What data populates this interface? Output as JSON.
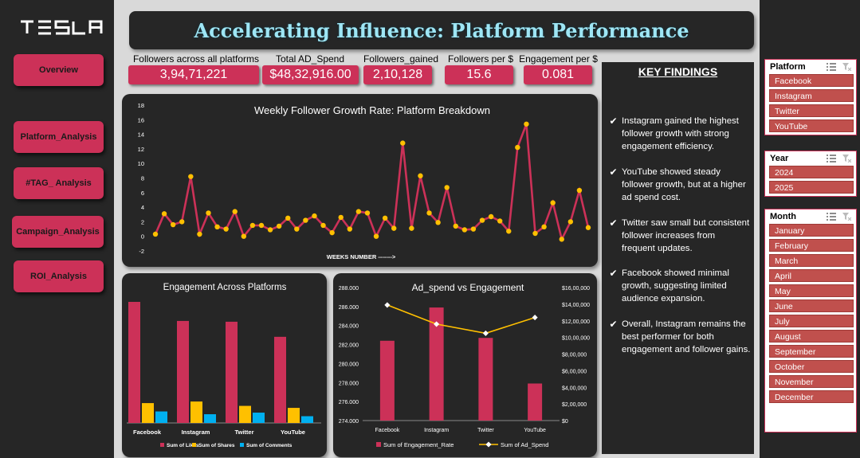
{
  "brand": {
    "logo_text": "TESLA"
  },
  "nav": [
    {
      "label": "Overview"
    },
    {
      "label": "Platform_Analysis"
    },
    {
      "label": "#TAG_ Analysis"
    },
    {
      "label": "Campaign_Analysis"
    },
    {
      "label": "ROI_Analysis"
    }
  ],
  "title": "Accelerating Influence: Platform Performance",
  "kpis": [
    {
      "label": "Followers across all platforms",
      "value": "3,94,71,221"
    },
    {
      "label": "Total AD_Spend",
      "value": "$48,32,916.00"
    },
    {
      "label": "Followers_gained",
      "value": "2,10,128"
    },
    {
      "label": "Followers per $",
      "value": "15.6"
    },
    {
      "label": "Engagement per $",
      "value": "0.081"
    }
  ],
  "findings": {
    "heading": "KEY FINDINGS",
    "items": [
      "Instagram gained the highest follower growth with strong engagement efficiency.",
      "YouTube showed steady follower growth, but at a higher ad spend cost.",
      "Twitter saw small but consistent follower increases from frequent updates.",
      "Facebook showed minimal growth, suggesting limited audience expansion.",
      "Overall, Instagram remains the best performer for both engagement and follower gains."
    ]
  },
  "slicers": {
    "platform": {
      "title": "Platform",
      "items": [
        "Facebook",
        "Instagram",
        "Twitter",
        "YouTube"
      ]
    },
    "year": {
      "title": "Year",
      "items": [
        "2024",
        "2025"
      ]
    },
    "month": {
      "title": "Month",
      "items": [
        "January",
        "February",
        "March",
        "April",
        "May",
        "June",
        "July",
        "August",
        "September",
        "October",
        "November",
        "December"
      ]
    }
  },
  "colors": {
    "accent": "#cc3158",
    "panel": "#262626",
    "line_marker": "#ffc000",
    "comments": "#00b0f0",
    "slicer_item": "#c0504d"
  },
  "chart_data": [
    {
      "type": "line",
      "title": "Weekly Follower Growth Rate: Platform Breakdown",
      "xlabel": "WEEKS NUMBER ------->",
      "ylabel": "",
      "ylim": [
        -2,
        18
      ],
      "yticks": [
        -2,
        0,
        2,
        4,
        6,
        8,
        10,
        12,
        14,
        16,
        18
      ],
      "series": [
        {
          "values": [
            0.3,
            3.1,
            1.6,
            2.0,
            8.2,
            0.3,
            3.2,
            1.3,
            1.0,
            3.4,
            0.0,
            1.5,
            1.5,
            0.9,
            1.4,
            2.5,
            1.0,
            2.2,
            2.8,
            1.5,
            0.5,
            2.6,
            1.0,
            3.4,
            3.2,
            0.0,
            2.5,
            1.1,
            12.8,
            1.1,
            8.3,
            3.2,
            1.9,
            6.7,
            1.4,
            0.9,
            1.0,
            2.2,
            2.7,
            2.1,
            0.7,
            12.2,
            15.4,
            0.4,
            1.3,
            4.6,
            -0.4,
            2.0,
            6.3,
            1.2
          ]
        }
      ]
    },
    {
      "type": "bar",
      "title": "Engagement Across Platforms",
      "categories": [
        "Facebook",
        "Instagram",
        "Twitter",
        "YouTube"
      ],
      "series": [
        {
          "name": "Sum of Likes",
          "values": [
            305,
            257,
            255,
            217
          ]
        },
        {
          "name": "Sum of Shares",
          "values": [
            50,
            54,
            43,
            38
          ]
        },
        {
          "name": "Sum of Comments",
          "values": [
            29,
            22,
            26,
            17
          ]
        }
      ]
    },
    {
      "type": "bar",
      "title": "Ad_spend vs Engagement",
      "categories": [
        "Facebook",
        "Instagram",
        "Twitter",
        "YouTube"
      ],
      "series": [
        {
          "name": "Sum of Engagement_Rate",
          "axis": "left",
          "type": "bar",
          "values": [
            282.4,
            285.9,
            282.7,
            277.9
          ]
        },
        {
          "name": "Sum of Ad_Spend",
          "axis": "right",
          "type": "line",
          "values": [
            1390000,
            1160000,
            1050000,
            1240000
          ]
        }
      ],
      "ylim_left": [
        274,
        288
      ],
      "yticks_left": [
        "274.000",
        "276.000",
        "278.000",
        "280.000",
        "282.000",
        "284.000",
        "286.000",
        "288.000"
      ],
      "ylim_right": [
        0,
        1600000
      ],
      "yticks_right": [
        "$0",
        "$2,00,000",
        "$4,00,000",
        "$6,00,000",
        "$8,00,000",
        "$10,00,000",
        "$12,00,000",
        "$14,00,000",
        "$16,00,000"
      ]
    }
  ]
}
